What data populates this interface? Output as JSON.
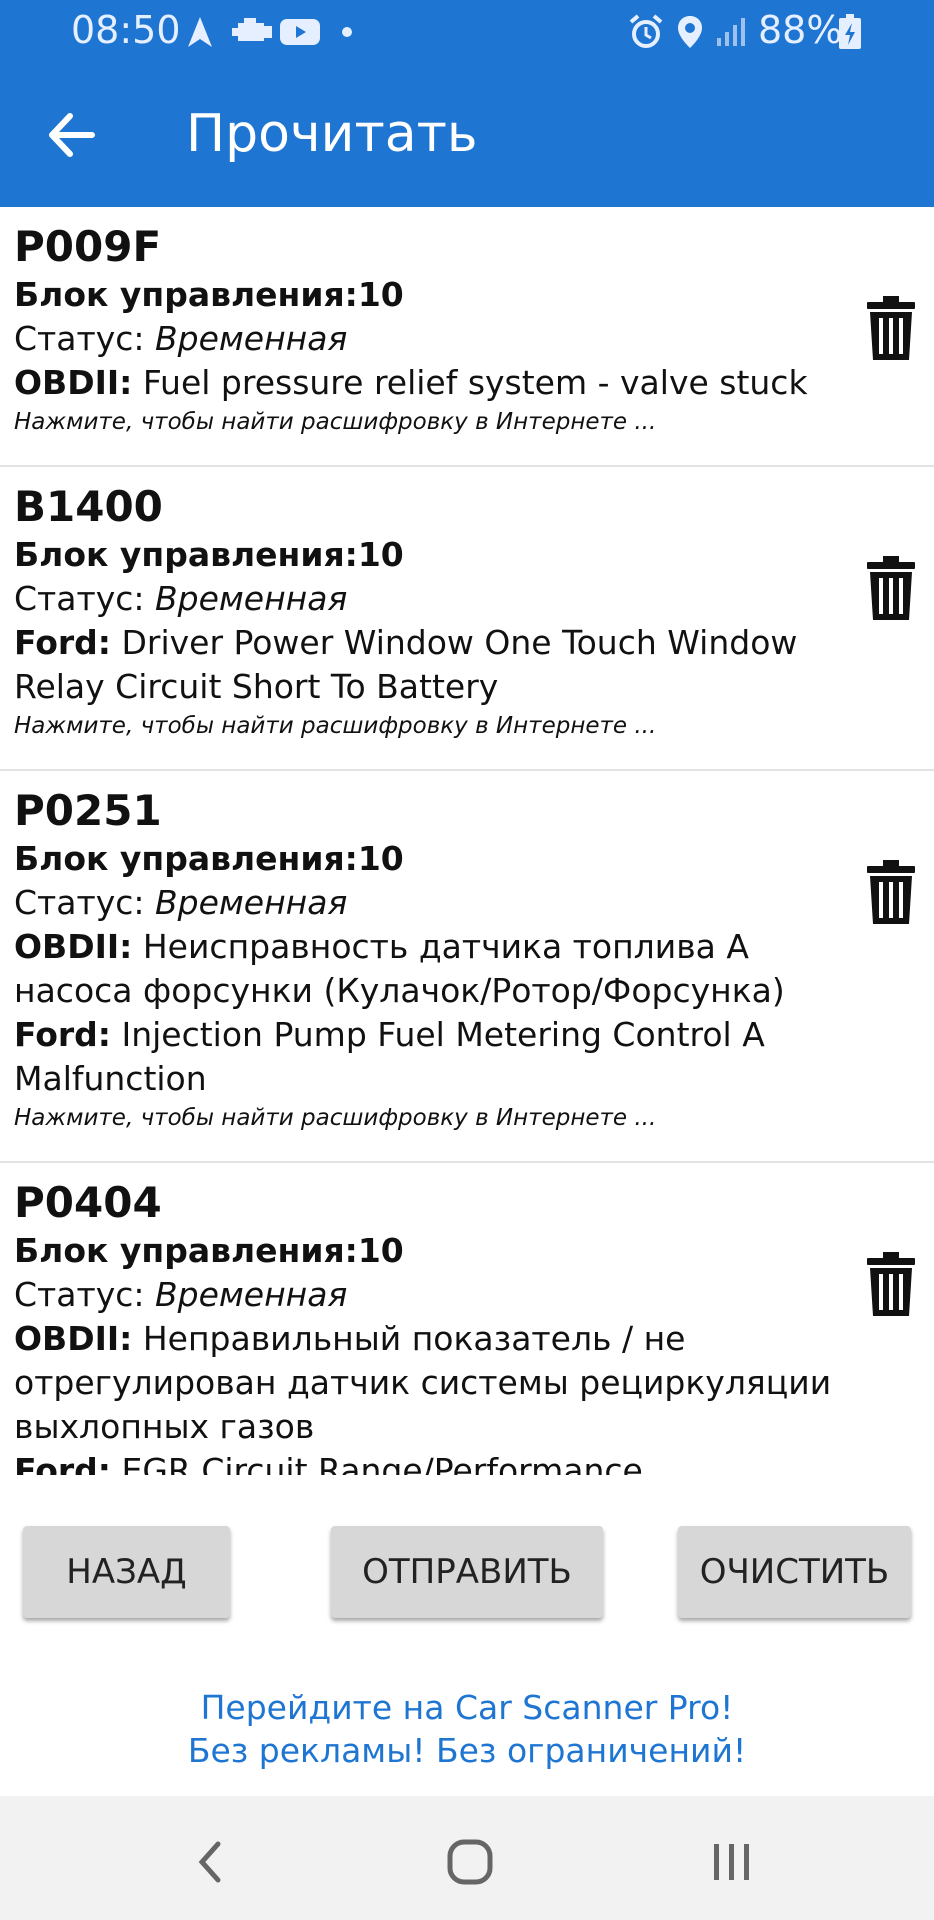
{
  "status_bar": {
    "time": "08:50",
    "battery": "88%"
  },
  "app_bar": {
    "title": "Прочитать"
  },
  "items": [
    {
      "code": "P009F",
      "ecu_label": "Блок управления:",
      "ecu_value": "10",
      "status_label": "Статус:",
      "status_value": "Временная",
      "desc1_label": "OBDII:",
      "desc1_text": "Fuel pressure relief system - valve stuck",
      "hint": "Нажмите, чтобы найти расшифровку в Интернете ..."
    },
    {
      "code": "B1400",
      "ecu_label": "Блок управления:",
      "ecu_value": "10",
      "status_label": "Статус:",
      "status_value": "Временная",
      "desc1_label": "Ford:",
      "desc1_text": "Driver Power Window One Touch Window Relay Circuit Short To Battery",
      "hint": "Нажмите, чтобы найти расшифровку в Интернете ..."
    },
    {
      "code": "P0251",
      "ecu_label": "Блок управления:",
      "ecu_value": "10",
      "status_label": "Статус:",
      "status_value": "Временная",
      "desc1_label": "OBDII:",
      "desc1_text": "Неисправность датчика топлива А насоса форсунки (Кулачок/Ротор/Форсунка)",
      "desc2_label": "Ford:",
      "desc2_text": "Injection Pump Fuel Metering Control A Malfunction",
      "hint": "Нажмите, чтобы найти расшифровку в Интернете ..."
    },
    {
      "code": "P0404",
      "ecu_label": "Блок управления:",
      "ecu_value": "10",
      "status_label": "Статус:",
      "status_value": "Временная",
      "desc1_label": "OBDII:",
      "desc1_text": "Неправильный показатель / не отрегулирован датчик системы рециркуляции выхлопных газов",
      "desc2_label": "Ford:",
      "desc2_text": "EGR Circuit Range/Performance"
    }
  ],
  "buttons": {
    "back": "НАЗАД",
    "send": "ОТПРАВИТЬ",
    "clear": "ОЧИСТИТЬ"
  },
  "promo": {
    "line1": "Перейдите на Car Scanner Pro!",
    "line2": "Без рекламы! Без ограничений!"
  },
  "icons": {
    "back": "arrow-left-icon",
    "trash": "trash-icon",
    "nav_back": "chevron-left-icon",
    "nav_home": "home-icon",
    "nav_recent": "recent-apps-icon"
  },
  "colors": {
    "primary": "#1f76d2",
    "button_bg": "#d7d7d7",
    "nav_bg": "#f2f2f2"
  }
}
